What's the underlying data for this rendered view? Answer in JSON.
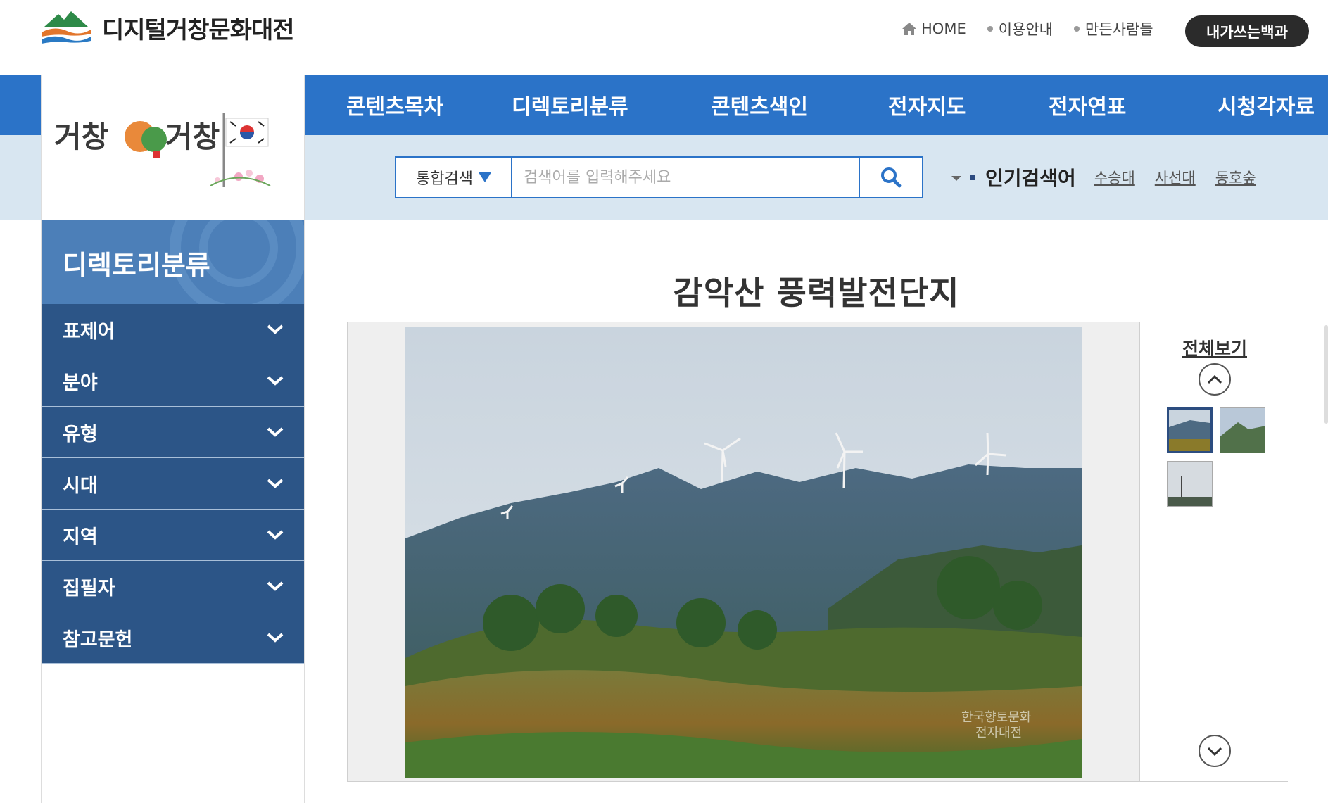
{
  "header": {
    "site_title": "디지털거창문화대전",
    "util_home": "HOME",
    "util_guide": "이용안내",
    "util_makers": "만든사람들",
    "my_button": "내가쓰는백과"
  },
  "gnb": [
    "콘텐츠목차",
    "디렉토리분류",
    "콘텐츠색인",
    "전자지도",
    "전자연표",
    "시청각자료"
  ],
  "search": {
    "scope": "통합검색",
    "placeholder": "검색어를 입력해주세요",
    "popular_title": "인기검색어",
    "popular_keywords": [
      "수승대",
      "사선대",
      "동호숲"
    ]
  },
  "side_logo": {
    "text_left": "거창",
    "text_right": "거창"
  },
  "sidebar": {
    "title": "디렉토리분류",
    "items": [
      "표제어",
      "분야",
      "유형",
      "시대",
      "지역",
      "집필자",
      "참고문헌"
    ]
  },
  "main": {
    "title": "감악산 풍력발전단지",
    "view_all": "전체보기",
    "watermark": "한국향토문화\n전자대전"
  },
  "colors": {
    "nav_blue": "#2b73c8",
    "search_band": "#d8e6f1",
    "sidebar_item": "#2c5587",
    "sidebar_head": "#4c7fb8"
  }
}
